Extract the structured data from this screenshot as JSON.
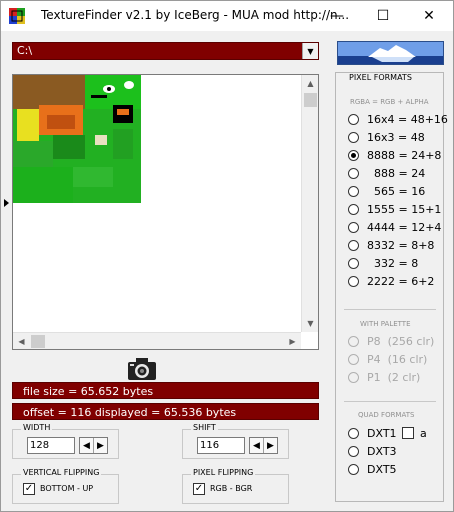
{
  "window": {
    "title": "TextureFinder v2.1 by IceBerg - MUA mod http://n...",
    "minimize_label": "—",
    "maximize_label": "☐",
    "close_label": "✕"
  },
  "path": {
    "value": "C:\\"
  },
  "viewer": {
    "file_size": "file size = 65.652 bytes",
    "offset_info": "offset = 116   displayed = 65.536 bytes"
  },
  "width": {
    "label": "WIDTH",
    "value": "128"
  },
  "shift": {
    "label": "SHIFT",
    "value": "116"
  },
  "vertical_flipping": {
    "label": "VERTICAL FLIPPING",
    "option": "BOTTOM - UP",
    "checked": true
  },
  "pixel_flipping": {
    "label": "PIXEL FLIPPING",
    "option": "RGB  -  BGR",
    "checked": true
  },
  "pixel_formats": {
    "label": "PIXEL FORMATS",
    "subtitle": "RGBA = RGB + ALPHA",
    "options": [
      "16x4 = 48+16",
      "16x3 = 48",
      "8888 = 24+8",
      "  888 = 24",
      "  565 = 16",
      "1555 = 15+1",
      "4444 = 12+4",
      "8332 = 8+8",
      "  332 = 8",
      "2222 = 6+2"
    ],
    "selected": "8888 = 24+8"
  },
  "with_palette": {
    "label": "WITH PALETTE",
    "options": [
      "P8  (256 clr)",
      "P4  (16 clr)",
      "P1  (2 clr)"
    ]
  },
  "quad_formats": {
    "label": "QUAD FORMATS",
    "options": [
      "DXT1",
      "DXT3",
      "DXT5"
    ],
    "alpha_label": "a"
  },
  "colors": {
    "bar": "#800000",
    "texture_green": "#22b022",
    "texture_orange": "#e8701a"
  }
}
